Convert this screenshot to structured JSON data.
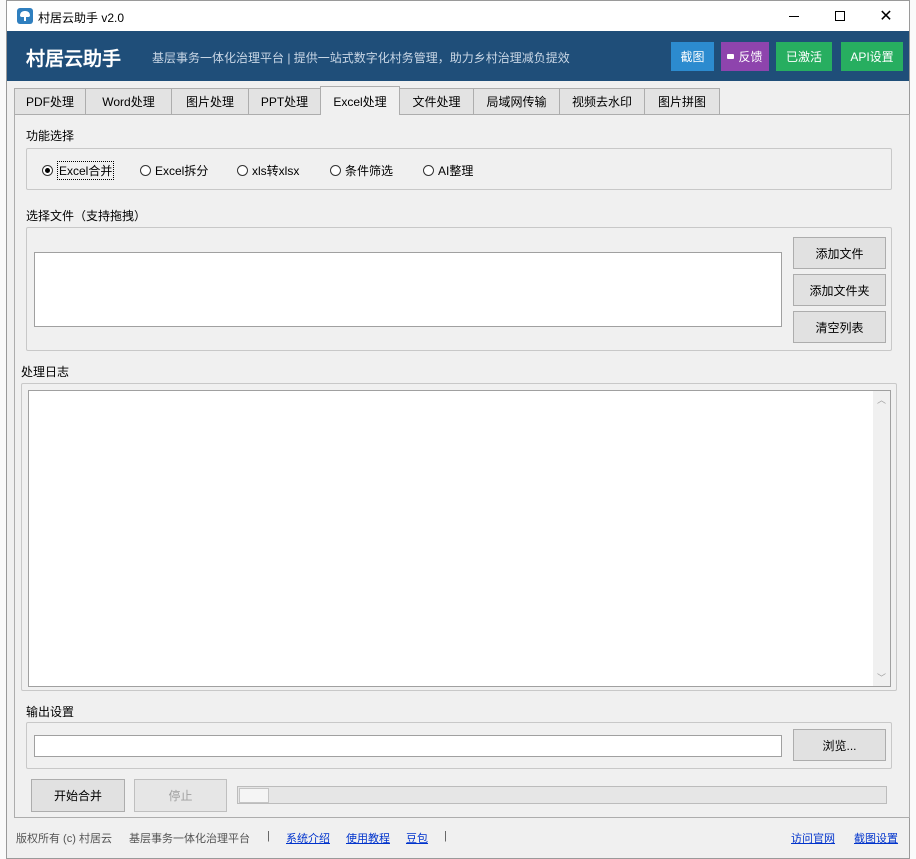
{
  "window": {
    "title": "村居云助手 v2.0"
  },
  "header": {
    "brand": "村居云助手",
    "slogan": "基层事务一体化治理平台 | 提供一站式数字化村务管理，助力乡村治理减负提效",
    "buttons": {
      "screenshot": "截图",
      "feedback": "反馈",
      "activated": "已激活",
      "api_settings": "API设置"
    },
    "colors": {
      "bar": "#1f4e79",
      "screenshot": "#2c8bcf",
      "feedback": "#8e44ad",
      "activated": "#27ae60",
      "api_settings": "#27ae60"
    }
  },
  "tabs": [
    {
      "label": "PDF处理"
    },
    {
      "label": "Word处理"
    },
    {
      "label": "图片处理"
    },
    {
      "label": "PPT处理"
    },
    {
      "label": "Excel处理"
    },
    {
      "label": "文件处理"
    },
    {
      "label": "局域网传输"
    },
    {
      "label": "视频去水印"
    },
    {
      "label": "图片拼图"
    }
  ],
  "active_tab": "Excel处理",
  "function_select": {
    "label": "功能选择",
    "options": [
      {
        "label": "Excel合并",
        "checked": true
      },
      {
        "label": "Excel拆分",
        "checked": false
      },
      {
        "label": "xls转xlsx",
        "checked": false
      },
      {
        "label": "条件筛选",
        "checked": false
      },
      {
        "label": "AI整理",
        "checked": false
      }
    ]
  },
  "file_select": {
    "label": "选择文件（支持拖拽）",
    "add_file": "添加文件",
    "add_folder": "添加文件夹",
    "clear_list": "清空列表"
  },
  "log": {
    "label": "处理日志"
  },
  "output": {
    "label": "输出设置",
    "path_value": "",
    "browse": "浏览..."
  },
  "actions": {
    "start": "开始合并",
    "stop": "停止",
    "progress": 0
  },
  "footer": {
    "copyright": "版权所有 (c) 村居云",
    "platform": "基层事务一体化治理平台",
    "sep": "|",
    "links": {
      "intro": "系统介绍",
      "tutorial": "使用教程",
      "doubao": "豆包",
      "website": "访问官网",
      "screenshot_settings": "截图设置"
    }
  }
}
